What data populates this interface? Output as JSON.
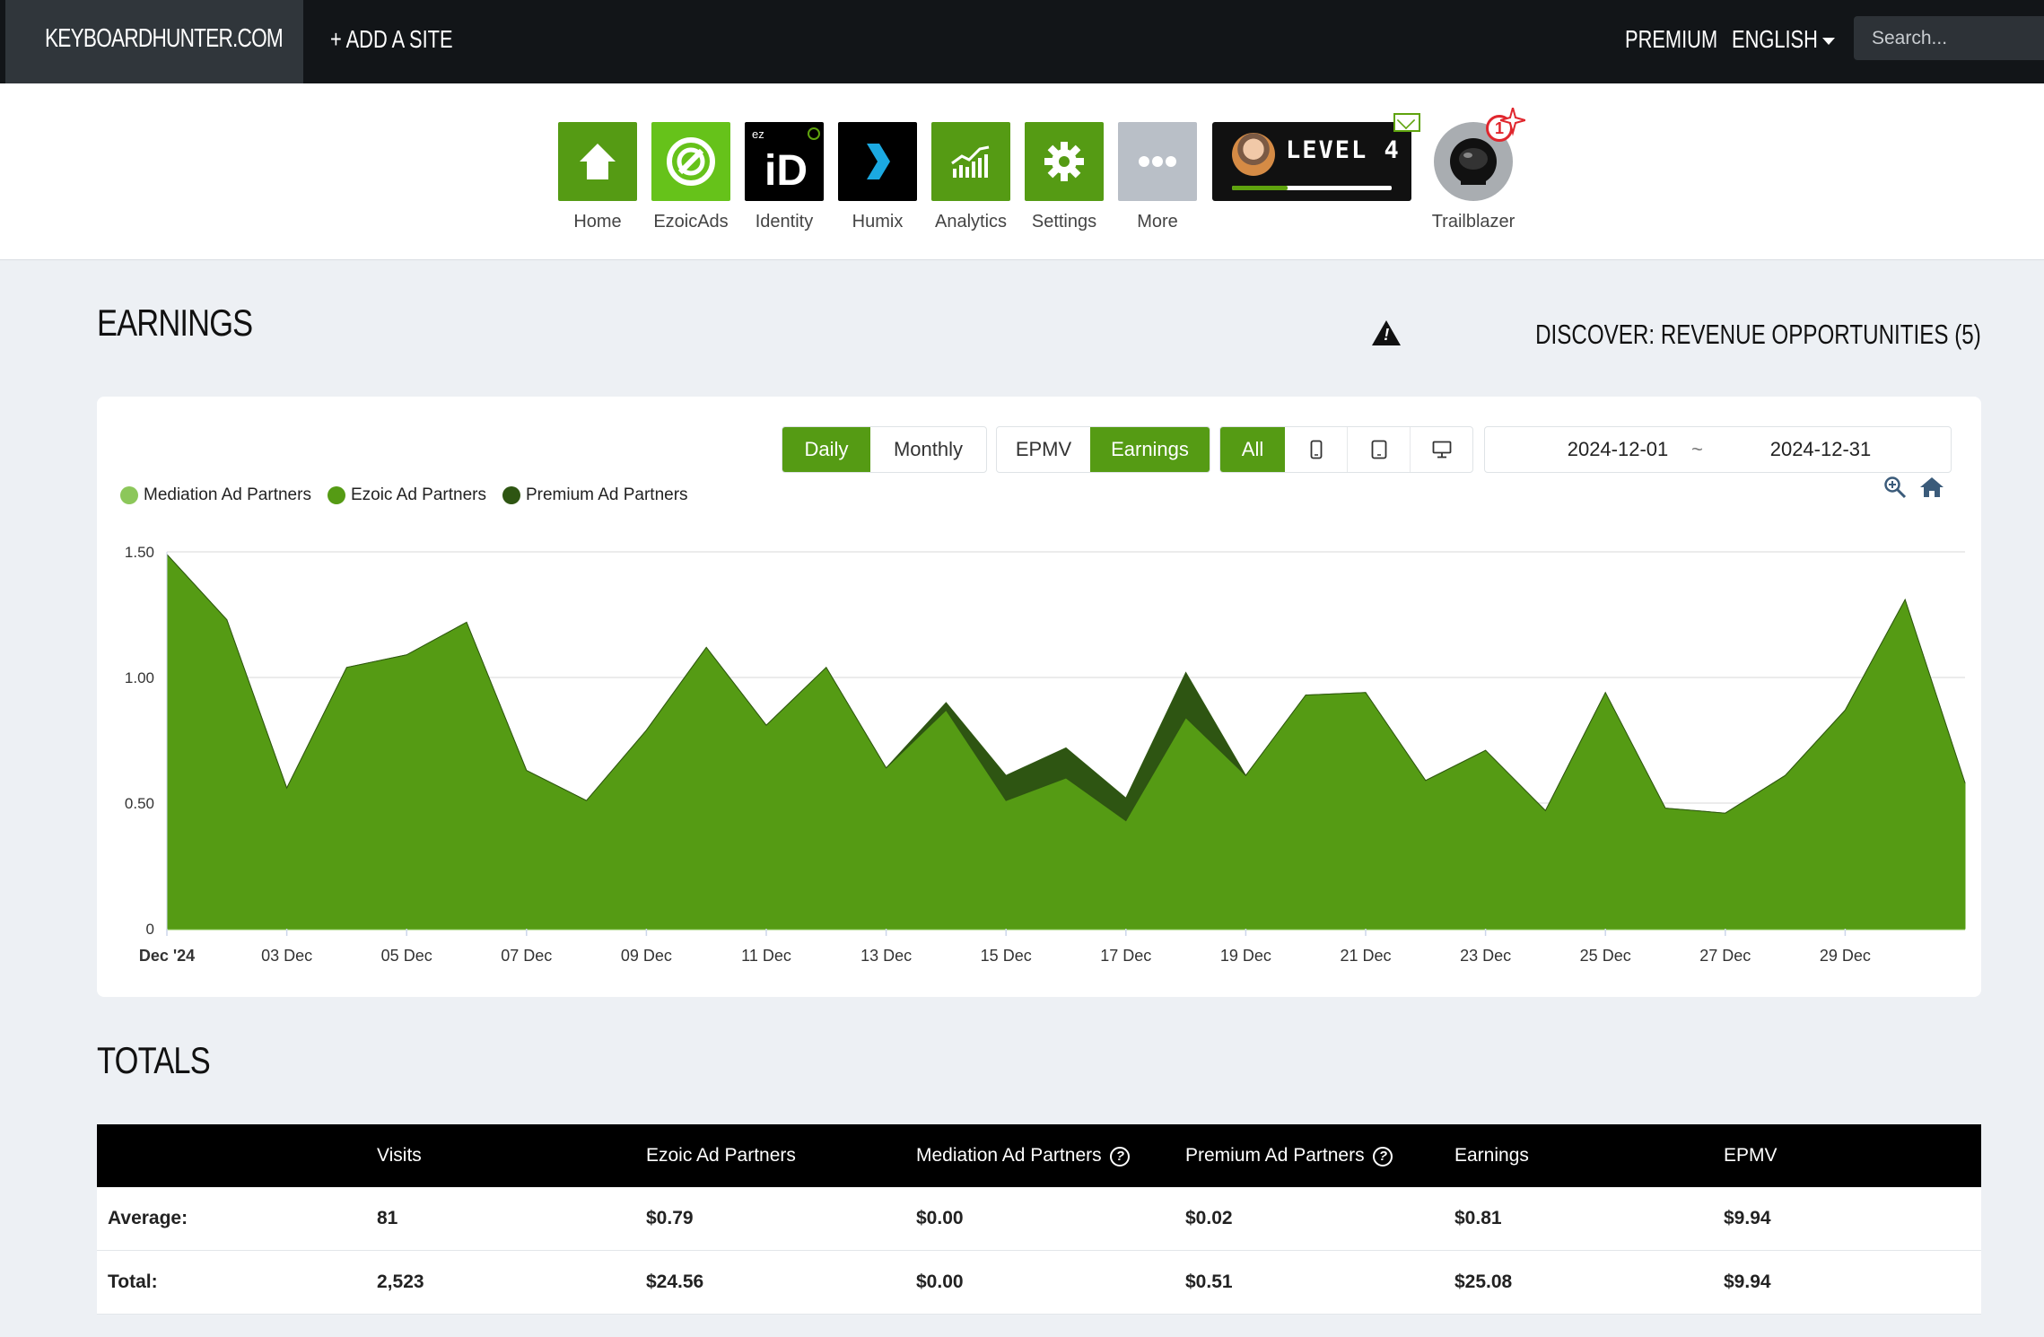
{
  "topbar": {
    "brand": "KEYBOARDHUNTER.COM",
    "add_site": "+ ADD A SITE",
    "premium": "PREMIUM",
    "language": "ENGLISH",
    "search_placeholder": "Search..."
  },
  "apps": [
    {
      "label": "Home",
      "icon": "home-icon"
    },
    {
      "label": "EzoicAds",
      "icon": "ezoicads-icon"
    },
    {
      "label": "Identity",
      "icon": "identity-icon"
    },
    {
      "label": "Humix",
      "icon": "humix-icon"
    },
    {
      "label": "Analytics",
      "icon": "analytics-icon"
    },
    {
      "label": "Settings",
      "icon": "gear-icon"
    },
    {
      "label": "More",
      "icon": "more-icon"
    }
  ],
  "level": {
    "text": "LEVEL 4",
    "progress": 0.35
  },
  "trailblazer": {
    "label": "Trailblazer",
    "badge": "1"
  },
  "earnings": {
    "title": "EARNINGS",
    "discover": "DISCOVER: REVENUE OPPORTUNITIES (5)",
    "period_buttons": [
      "Daily",
      "Monthly"
    ],
    "period_selected": "Daily",
    "metric_buttons": [
      "EPMV",
      "Earnings"
    ],
    "metric_selected": "Earnings",
    "device_buttons": [
      "All",
      "mobile-icon",
      "tablet-icon",
      "desktop-icon"
    ],
    "device_selected": "All",
    "date_from": "2024-12-01",
    "date_sep": "~",
    "date_to": "2024-12-31"
  },
  "colors": {
    "accent": "#559b14",
    "mediation": "#8cc75a",
    "ezoic": "#559b14",
    "premium": "#2e5512"
  },
  "chart_data": {
    "type": "area",
    "stacked": true,
    "x": [
      "2024-12-01",
      "2024-12-02",
      "2024-12-03",
      "2024-12-04",
      "2024-12-05",
      "2024-12-06",
      "2024-12-07",
      "2024-12-08",
      "2024-12-09",
      "2024-12-10",
      "2024-12-11",
      "2024-12-12",
      "2024-12-13",
      "2024-12-14",
      "2024-12-15",
      "2024-12-16",
      "2024-12-17",
      "2024-12-18",
      "2024-12-19",
      "2024-12-20",
      "2024-12-21",
      "2024-12-22",
      "2024-12-23",
      "2024-12-24",
      "2024-12-25",
      "2024-12-26",
      "2024-12-27",
      "2024-12-28",
      "2024-12-29",
      "2024-12-30",
      "2024-12-31"
    ],
    "x_tick_labels": [
      "Dec '24",
      "03 Dec",
      "05 Dec",
      "07 Dec",
      "09 Dec",
      "11 Dec",
      "13 Dec",
      "15 Dec",
      "17 Dec",
      "19 Dec",
      "21 Dec",
      "23 Dec",
      "25 Dec",
      "27 Dec",
      "29 Dec"
    ],
    "y_ticks": [
      "0",
      "0.50",
      "1.00",
      "1.50"
    ],
    "ylim": [
      0,
      1.5
    ],
    "grid": true,
    "legend_position": "top-left",
    "series": [
      {
        "name": "Mediation Ad Partners",
        "values": [
          0,
          0,
          0,
          0,
          0,
          0,
          0,
          0,
          0,
          0,
          0,
          0,
          0,
          0,
          0,
          0,
          0,
          0,
          0,
          0,
          0,
          0,
          0,
          0,
          0,
          0,
          0,
          0,
          0,
          0,
          0
        ]
      },
      {
        "name": "Ezoic Ad Partners",
        "values": [
          1.49,
          1.23,
          0.56,
          1.04,
          1.09,
          1.22,
          0.63,
          0.51,
          0.79,
          1.12,
          0.81,
          1.04,
          0.64,
          0.87,
          0.51,
          0.6,
          0.43,
          0.84,
          0.61,
          0.93,
          0.94,
          0.59,
          0.71,
          0.47,
          0.94,
          0.48,
          0.46,
          0.61,
          0.87,
          1.31,
          0.58
        ]
      },
      {
        "name": "Premium Ad Partners",
        "values": [
          0,
          0,
          0,
          0,
          0,
          0,
          0,
          0,
          0,
          0,
          0,
          0,
          0,
          0.03,
          0.1,
          0.12,
          0.09,
          0.18,
          0,
          0,
          0,
          0,
          0,
          0,
          0,
          0,
          0,
          0,
          0,
          0,
          0
        ]
      }
    ]
  },
  "totals": {
    "title": "TOTALS",
    "columns": [
      "",
      "Visits",
      "Ezoic Ad Partners",
      "Mediation Ad Partners",
      "Premium Ad Partners",
      "Earnings",
      "EPMV"
    ],
    "rows": [
      [
        "Average:",
        "81",
        "$0.79",
        "$0.00",
        "$0.02",
        "$0.81",
        "$9.94"
      ],
      [
        "Total:",
        "2,523",
        "$24.56",
        "$0.00",
        "$0.51",
        "$25.08",
        "$9.94"
      ]
    ]
  }
}
